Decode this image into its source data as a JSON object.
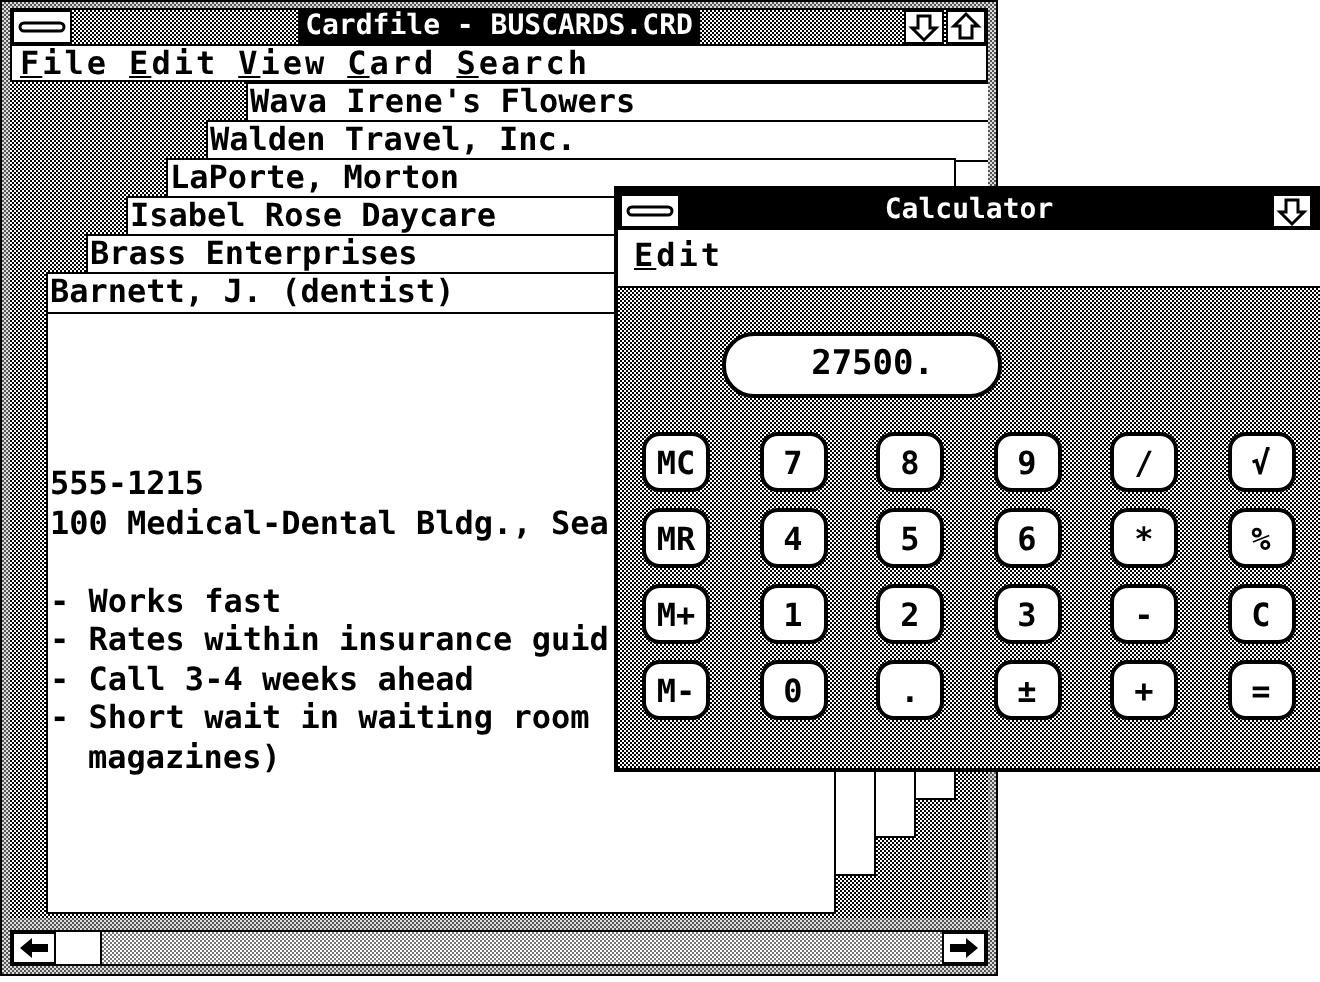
{
  "cardfile": {
    "title": "Cardfile - BUSCARDS.CRD",
    "menu": [
      {
        "label": "File"
      },
      {
        "label": "Edit"
      },
      {
        "label": "View"
      },
      {
        "label": "Card"
      },
      {
        "label": "Search"
      }
    ],
    "cards": [
      {
        "title": "Wava Irene's Flowers"
      },
      {
        "title": "Walden Travel, Inc."
      },
      {
        "title": "LaPorte, Morton"
      },
      {
        "title": "Isabel Rose Daycare"
      },
      {
        "title": "Brass Enterprises"
      },
      {
        "title": "Barnett, J. (dentist)"
      }
    ],
    "card_body": [
      [
        {
          "text": "555-1215",
          "kind": "line"
        },
        {
          "text": "100 Medical-Dental Bldg., Sea",
          "kind": "line"
        }
      ],
      [
        {
          "text": "- Works fast",
          "kind": "line"
        },
        {
          "text": "- Rates within insurance guid",
          "kind": "line"
        },
        {
          "text": "- Call 3-4 weeks ahead",
          "kind": "line"
        },
        {
          "text": "- Short wait in waiting room",
          "kind": "line"
        },
        {
          "text": "magazines)",
          "kind": "wrap"
        }
      ]
    ]
  },
  "calculator": {
    "title": "Calculator",
    "menu": [
      {
        "label": "Edit"
      }
    ],
    "display": "27500.",
    "keys": [
      [
        "MC",
        "7",
        "8",
        "9",
        "/",
        "√"
      ],
      [
        "MR",
        "4",
        "5",
        "6",
        "*",
        "%"
      ],
      [
        "M+",
        "1",
        "2",
        "3",
        "-",
        "C"
      ],
      [
        "M-",
        "0",
        ".",
        "±",
        "+",
        "="
      ]
    ]
  }
}
